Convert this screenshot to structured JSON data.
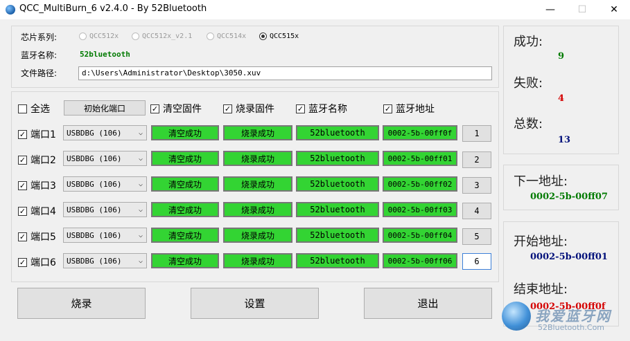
{
  "window": {
    "title": "QCC_MultiBurn_6 v2.4.0 - By 52Bluetooth",
    "minimize_glyph": "—",
    "maximize_glyph": "☐",
    "close_glyph": "✕"
  },
  "chip": {
    "label": "芯片系列:",
    "options": [
      "QCC512x",
      "QCC512x_v2.1",
      "QCC514x",
      "QCC515x"
    ],
    "selected": "QCC515x"
  },
  "bt_name": {
    "label": "蓝牙名称:",
    "value": "52bluetooth"
  },
  "file_path": {
    "label": "文件路径:",
    "value": "d:\\Users\\Administrator\\Desktop\\3050.xuv"
  },
  "options_row": {
    "select_all": "全选",
    "init_port_button": "初始化端口",
    "clear_firmware": "清空固件",
    "burn_firmware": "烧录固件",
    "bt_name": "蓝牙名称",
    "bt_address": "蓝牙地址"
  },
  "ports": [
    {
      "label": "端口1",
      "device": "USBDBG (106)",
      "clear_status": "清空成功",
      "burn_status": "烧录成功",
      "name": "52bluetooth",
      "address": "0002-5b-00ff0f",
      "number": "1"
    },
    {
      "label": "端口2",
      "device": "USBDBG (106)",
      "clear_status": "清空成功",
      "burn_status": "烧录成功",
      "name": "52bluetooth",
      "address": "0002-5b-00ff01",
      "number": "2"
    },
    {
      "label": "端口3",
      "device": "USBDBG (106)",
      "clear_status": "清空成功",
      "burn_status": "烧录成功",
      "name": "52bluetooth",
      "address": "0002-5b-00ff02",
      "number": "3"
    },
    {
      "label": "端口4",
      "device": "USBDBG (106)",
      "clear_status": "清空成功",
      "burn_status": "烧录成功",
      "name": "52bluetooth",
      "address": "0002-5b-00ff03",
      "number": "4"
    },
    {
      "label": "端口5",
      "device": "USBDBG (106)",
      "clear_status": "清空成功",
      "burn_status": "烧录成功",
      "name": "52bluetooth",
      "address": "0002-5b-00ff04",
      "number": "5"
    },
    {
      "label": "端口6",
      "device": "USBDBG (106)",
      "clear_status": "清空成功",
      "burn_status": "烧录成功",
      "name": "52bluetooth",
      "address": "0002-5b-00ff06",
      "number": "6"
    }
  ],
  "stats": {
    "success_label": "成功:",
    "success_value": "9",
    "fail_label": "失败:",
    "fail_value": "4",
    "total_label": "总数:",
    "total_value": "13"
  },
  "next_address": {
    "label": "下一地址:",
    "value": "0002-5b-00ff07"
  },
  "range": {
    "start_label": "开始地址:",
    "start_value": "0002-5b-00ff01",
    "end_label": "结束地址:",
    "end_value": "0002-5b-00ff0f"
  },
  "actions": {
    "burn": "烧录",
    "settings": "设置",
    "exit": "退出"
  },
  "watermark": {
    "text": "我爱蓝牙网",
    "url": "52Bluetooth.Com"
  },
  "colors": {
    "success": "#33d433",
    "green_text": "#007a00",
    "red_text": "#d40000",
    "blue_text": "#00107a"
  }
}
